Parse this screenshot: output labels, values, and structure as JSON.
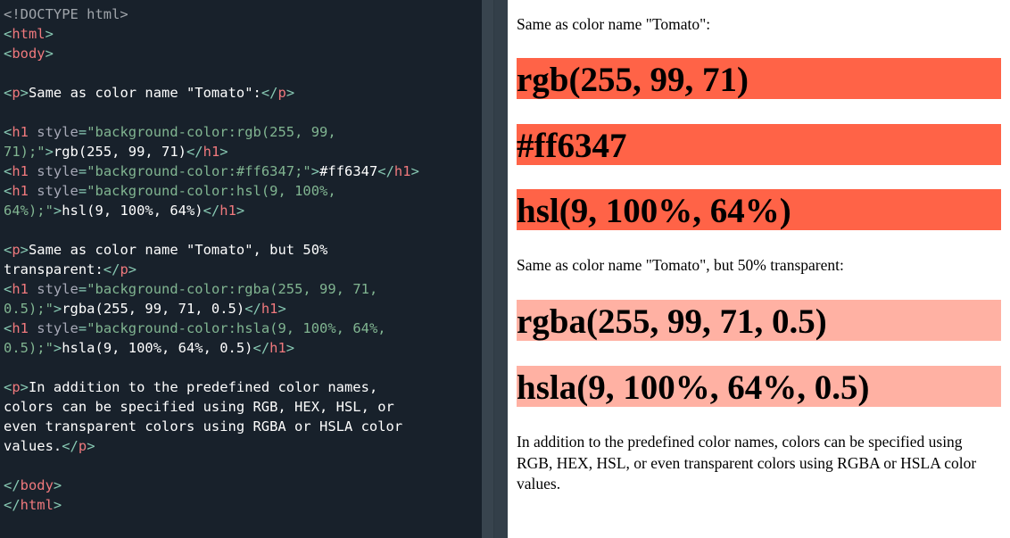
{
  "editor": {
    "lines": [
      [
        {
          "t": "doctype",
          "v": "<!DOCTYPE html>"
        }
      ],
      [
        {
          "t": "punct",
          "v": "<"
        },
        {
          "t": "tag",
          "v": "html"
        },
        {
          "t": "punct",
          "v": ">"
        }
      ],
      [
        {
          "t": "punct",
          "v": "<"
        },
        {
          "t": "tag",
          "v": "body"
        },
        {
          "t": "punct",
          "v": ">"
        }
      ],
      [],
      [
        {
          "t": "punct",
          "v": "<"
        },
        {
          "t": "tag",
          "v": "p"
        },
        {
          "t": "punct",
          "v": ">"
        },
        {
          "t": "text",
          "v": "Same as color name \"Tomato\":"
        },
        {
          "t": "punct",
          "v": "</"
        },
        {
          "t": "tag",
          "v": "p"
        },
        {
          "t": "punct",
          "v": ">"
        }
      ],
      [],
      [
        {
          "t": "punct",
          "v": "<"
        },
        {
          "t": "tag",
          "v": "h1"
        },
        {
          "t": "attr",
          "v": " style"
        },
        {
          "t": "punct",
          "v": "="
        },
        {
          "t": "str",
          "v": "\"background-color:rgb(255, 99,"
        }
      ],
      [
        {
          "t": "str",
          "v": "71);\""
        },
        {
          "t": "punct",
          "v": ">"
        },
        {
          "t": "text",
          "v": "rgb(255, 99, 71)"
        },
        {
          "t": "punct",
          "v": "</"
        },
        {
          "t": "tag",
          "v": "h1"
        },
        {
          "t": "punct",
          "v": ">"
        }
      ],
      [
        {
          "t": "punct",
          "v": "<"
        },
        {
          "t": "tag",
          "v": "h1"
        },
        {
          "t": "attr",
          "v": " style"
        },
        {
          "t": "punct",
          "v": "="
        },
        {
          "t": "str",
          "v": "\"background-color:#ff6347;\""
        },
        {
          "t": "punct",
          "v": ">"
        },
        {
          "t": "text",
          "v": "#ff6347"
        },
        {
          "t": "punct",
          "v": "</"
        },
        {
          "t": "tag",
          "v": "h1"
        },
        {
          "t": "punct",
          "v": ">"
        }
      ],
      [
        {
          "t": "punct",
          "v": "<"
        },
        {
          "t": "tag",
          "v": "h1"
        },
        {
          "t": "attr",
          "v": " style"
        },
        {
          "t": "punct",
          "v": "="
        },
        {
          "t": "str",
          "v": "\"background-color:hsl(9, 100%,"
        }
      ],
      [
        {
          "t": "str",
          "v": "64%);\""
        },
        {
          "t": "punct",
          "v": ">"
        },
        {
          "t": "text",
          "v": "hsl(9, 100%, 64%)"
        },
        {
          "t": "punct",
          "v": "</"
        },
        {
          "t": "tag",
          "v": "h1"
        },
        {
          "t": "punct",
          "v": ">"
        }
      ],
      [],
      [
        {
          "t": "punct",
          "v": "<"
        },
        {
          "t": "tag",
          "v": "p"
        },
        {
          "t": "punct",
          "v": ">"
        },
        {
          "t": "text",
          "v": "Same as color name \"Tomato\", but 50%"
        }
      ],
      [
        {
          "t": "text",
          "v": "transparent:"
        },
        {
          "t": "punct",
          "v": "</"
        },
        {
          "t": "tag",
          "v": "p"
        },
        {
          "t": "punct",
          "v": ">"
        }
      ],
      [
        {
          "t": "punct",
          "v": "<"
        },
        {
          "t": "tag",
          "v": "h1"
        },
        {
          "t": "attr",
          "v": " style"
        },
        {
          "t": "punct",
          "v": "="
        },
        {
          "t": "str",
          "v": "\"background-color:rgba(255, 99, 71,"
        }
      ],
      [
        {
          "t": "str",
          "v": "0.5);\""
        },
        {
          "t": "punct",
          "v": ">"
        },
        {
          "t": "text",
          "v": "rgba(255, 99, 71, 0.5)"
        },
        {
          "t": "punct",
          "v": "</"
        },
        {
          "t": "tag",
          "v": "h1"
        },
        {
          "t": "punct",
          "v": ">"
        }
      ],
      [
        {
          "t": "punct",
          "v": "<"
        },
        {
          "t": "tag",
          "v": "h1"
        },
        {
          "t": "attr",
          "v": " style"
        },
        {
          "t": "punct",
          "v": "="
        },
        {
          "t": "str",
          "v": "\"background-color:hsla(9, 100%, 64%,"
        }
      ],
      [
        {
          "t": "str",
          "v": "0.5);\""
        },
        {
          "t": "punct",
          "v": ">"
        },
        {
          "t": "text",
          "v": "hsla(9, 100%, 64%, 0.5)"
        },
        {
          "t": "punct",
          "v": "</"
        },
        {
          "t": "tag",
          "v": "h1"
        },
        {
          "t": "punct",
          "v": ">"
        }
      ],
      [],
      [
        {
          "t": "punct",
          "v": "<"
        },
        {
          "t": "tag",
          "v": "p"
        },
        {
          "t": "punct",
          "v": ">"
        },
        {
          "t": "text",
          "v": "In addition to the predefined color names,"
        }
      ],
      [
        {
          "t": "text",
          "v": "colors can be specified using RGB, HEX, HSL, or"
        }
      ],
      [
        {
          "t": "text",
          "v": "even transparent colors using RGBA or HSLA color"
        }
      ],
      [
        {
          "t": "text",
          "v": "values."
        },
        {
          "t": "punct",
          "v": "</"
        },
        {
          "t": "tag",
          "v": "p"
        },
        {
          "t": "punct",
          "v": ">"
        }
      ],
      [],
      [
        {
          "t": "punct",
          "v": "</"
        },
        {
          "t": "tag",
          "v": "body"
        },
        {
          "t": "punct",
          "v": ">"
        }
      ],
      [
        {
          "t": "punct",
          "v": "</"
        },
        {
          "t": "tag",
          "v": "html"
        },
        {
          "t": "punct",
          "v": ">"
        }
      ]
    ]
  },
  "output": {
    "p1": "Same as color name \"Tomato\":",
    "h1_rgb": "rgb(255, 99, 71)",
    "h1_hex": "#ff6347",
    "h1_hsl": "hsl(9, 100%, 64%)",
    "p2": "Same as color name \"Tomato\", but 50% transparent:",
    "h1_rgba": "rgba(255, 99, 71, 0.5)",
    "h1_hsla": "hsla(9, 100%, 64%, 0.5)",
    "p3": "In addition to the predefined color names, colors can be specified using RGB, HEX, HSL, or even transparent colors using RGBA or HSLA color values.",
    "colors": {
      "rgb": "rgb(255, 99, 71)",
      "hex": "#ff6347",
      "hsl": "hsl(9, 100%, 64%)",
      "rgba": "rgba(255, 99, 71, 0.5)",
      "hsla": "hsla(9, 100%, 64%, 0.5)"
    }
  }
}
